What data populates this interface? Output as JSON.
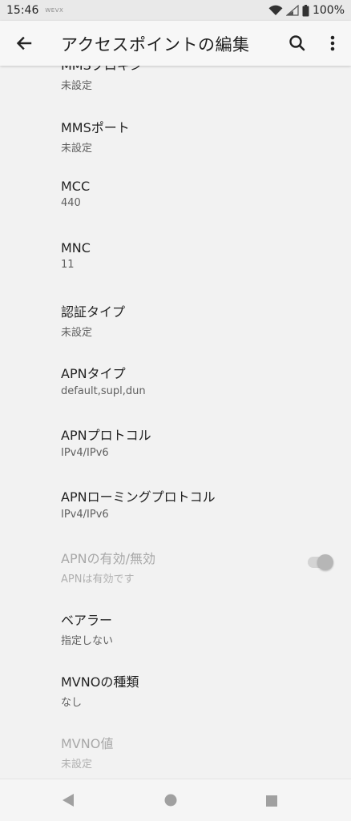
{
  "status_bar": {
    "time": "15:46",
    "carrier_small": "WEVX",
    "battery": "100%"
  },
  "app_bar": {
    "title": "アクセスポイントの編集",
    "icons": [
      "back-arrow-icon",
      "search-icon",
      "more-vert-icon"
    ]
  },
  "items": [
    {
      "title": "MMSプロキシ",
      "summary": "未設定",
      "enabled": true
    },
    {
      "title": "MMSポート",
      "summary": "未設定",
      "enabled": true
    },
    {
      "title": "MCC",
      "summary": "440",
      "enabled": true
    },
    {
      "title": "MNC",
      "summary": "11",
      "enabled": true
    },
    {
      "title": "認証タイプ",
      "summary": "未設定",
      "enabled": true
    },
    {
      "title": "APNタイプ",
      "summary": "default,supl,dun",
      "enabled": true
    },
    {
      "title": "APNプロトコル",
      "summary": "IPv4/IPv6",
      "enabled": true
    },
    {
      "title": "APNローミングプロトコル",
      "summary": "IPv4/IPv6",
      "enabled": true
    },
    {
      "title": "APNの有効/無効",
      "summary": "APNは有効です",
      "enabled": false,
      "toggle_on": true
    },
    {
      "title": "ベアラー",
      "summary": "指定しない",
      "enabled": true
    },
    {
      "title": "MVNOの種類",
      "summary": "なし",
      "enabled": true
    },
    {
      "title": "MVNO値",
      "summary": "未設定",
      "enabled": false
    }
  ],
  "nav_bar": {
    "icons": [
      "nav-back-icon",
      "nav-home-icon",
      "nav-recents-icon"
    ]
  }
}
